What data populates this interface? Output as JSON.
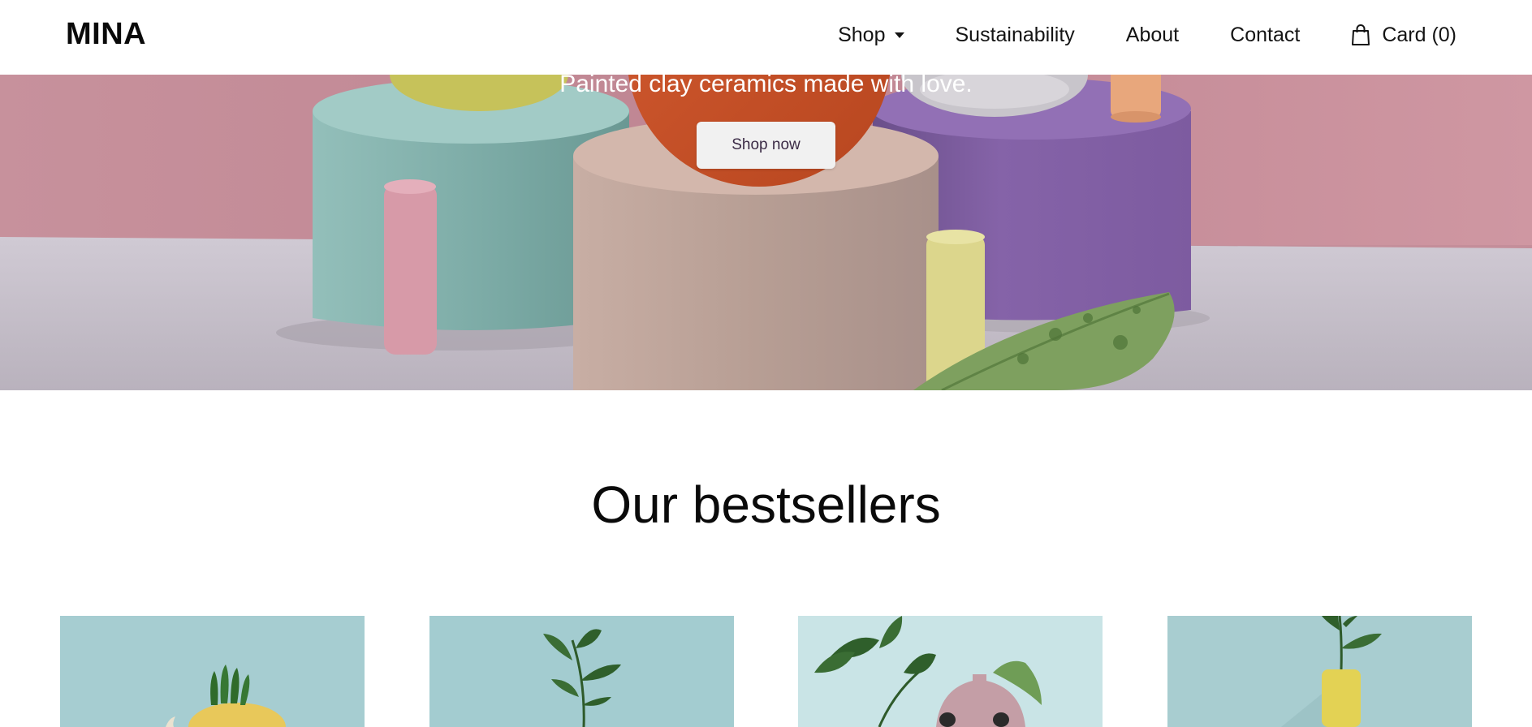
{
  "header": {
    "logo": "MINA",
    "nav": {
      "shop": "Shop",
      "sustainability": "Sustainability",
      "about": "About",
      "contact": "Contact",
      "cart": "Card (0)"
    }
  },
  "hero": {
    "tagline": "Painted clay ceramics made with love.",
    "cta": "Shop now"
  },
  "bestsellers": {
    "title": "Our bestsellers",
    "products": [
      {
        "icon": "yellow-vase-succulent-image"
      },
      {
        "icon": "plant-sprig-image"
      },
      {
        "icon": "pink-vase-plants-image"
      },
      {
        "icon": "yellow-tube-vase-image"
      }
    ]
  },
  "colors": {
    "hero_wall": "#c48e9a",
    "hero_floor": "#c9c3cc",
    "product_bg": "#a6cdd1",
    "button_bg": "#f1f1f1"
  }
}
